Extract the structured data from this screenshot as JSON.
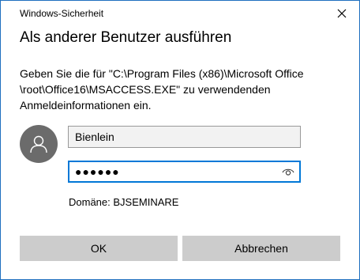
{
  "window": {
    "title": "Windows-Sicherheit",
    "close_icon": "close-icon"
  },
  "dialog": {
    "heading": "Als anderer Benutzer ausführen",
    "message": "Geben Sie die für \"C:\\Program Files (x86)\\Microsoft Office \\root\\Office16\\MSACCESS.EXE\" zu verwendenden Anmeldeinformationen ein."
  },
  "credentials": {
    "avatar_icon": "user-avatar-icon",
    "username_value": "Bienlein",
    "password_mask": "●●●●●●",
    "reveal_icon": "eye-icon",
    "domain_text": "Domäne: BJSEMINARE"
  },
  "buttons": {
    "ok_label": "OK",
    "cancel_label": "Abbrechen"
  },
  "colors": {
    "accent": "#0078d7",
    "window_border": "#1f6fbf",
    "button_bg": "#cccccc",
    "avatar_bg": "#6b6b6b"
  }
}
